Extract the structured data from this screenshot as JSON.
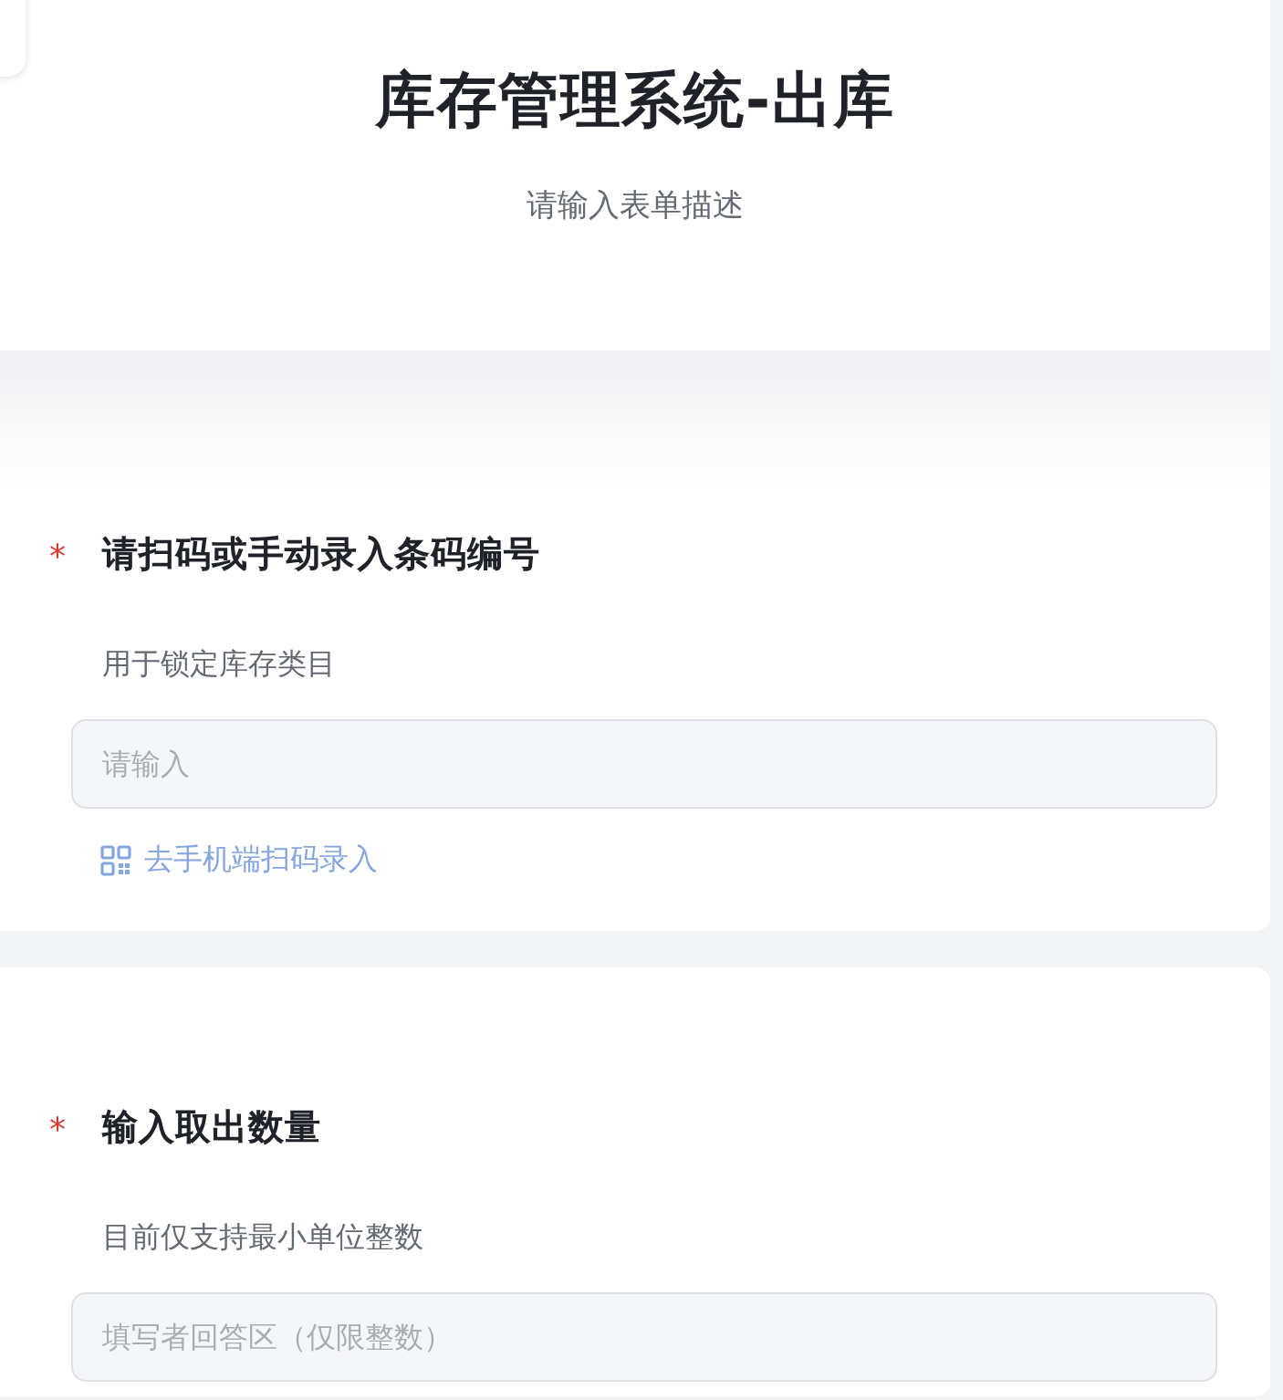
{
  "header": {
    "title": "库存管理系统-出库",
    "description": "请输入表单描述"
  },
  "questions": [
    {
      "required_mark": "*",
      "title": "请扫码或手动录入条码编号",
      "description": "用于锁定库存类目",
      "input": {
        "placeholder": "请输入"
      },
      "scan_link": {
        "label": "去手机端扫码录入",
        "disabled": true
      }
    },
    {
      "required_mark": "*",
      "title": "输入取出数量",
      "description": "目前仅支持最小单位整数",
      "input": {
        "placeholder": "填写者回答区（仅限整数）"
      }
    }
  ]
}
